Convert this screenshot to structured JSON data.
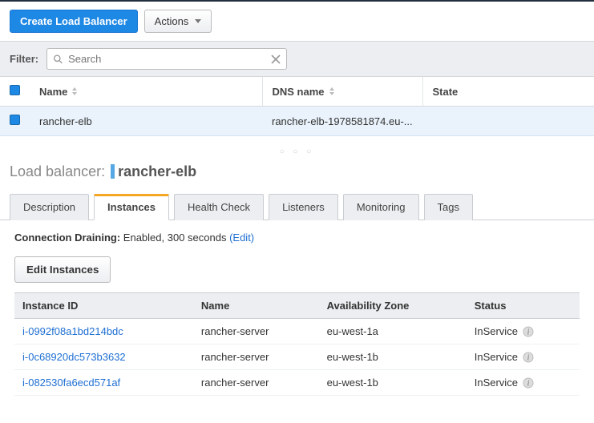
{
  "toolbar": {
    "create_label": "Create Load Balancer",
    "actions_label": "Actions"
  },
  "filter": {
    "label": "Filter:",
    "placeholder": "Search",
    "value": ""
  },
  "lb_columns": {
    "name": "Name",
    "dns": "DNS name",
    "state": "State"
  },
  "lb_rows": [
    {
      "name": "rancher-elb",
      "dns": "rancher-elb-1978581874.eu-...",
      "state": ""
    }
  ],
  "detail": {
    "prefix": "Load balancer:",
    "name": "rancher-elb"
  },
  "tabs": [
    "Description",
    "Instances",
    "Health Check",
    "Listeners",
    "Monitoring",
    "Tags"
  ],
  "active_tab": "Instances",
  "connection_draining": {
    "label": "Connection Draining:",
    "value": "Enabled, 300 seconds",
    "edit": "(Edit)"
  },
  "edit_instances_label": "Edit Instances",
  "inst_columns": {
    "id": "Instance ID",
    "name": "Name",
    "az": "Availability Zone",
    "status": "Status"
  },
  "instances": [
    {
      "id": "i-0992f08a1bd214bdc",
      "name": "rancher-server",
      "az": "eu-west-1a",
      "status": "InService"
    },
    {
      "id": "i-0c68920dc573b3632",
      "name": "rancher-server",
      "az": "eu-west-1b",
      "status": "InService"
    },
    {
      "id": "i-082530fa6ecd571af",
      "name": "rancher-server",
      "az": "eu-west-1b",
      "status": "InService"
    }
  ]
}
